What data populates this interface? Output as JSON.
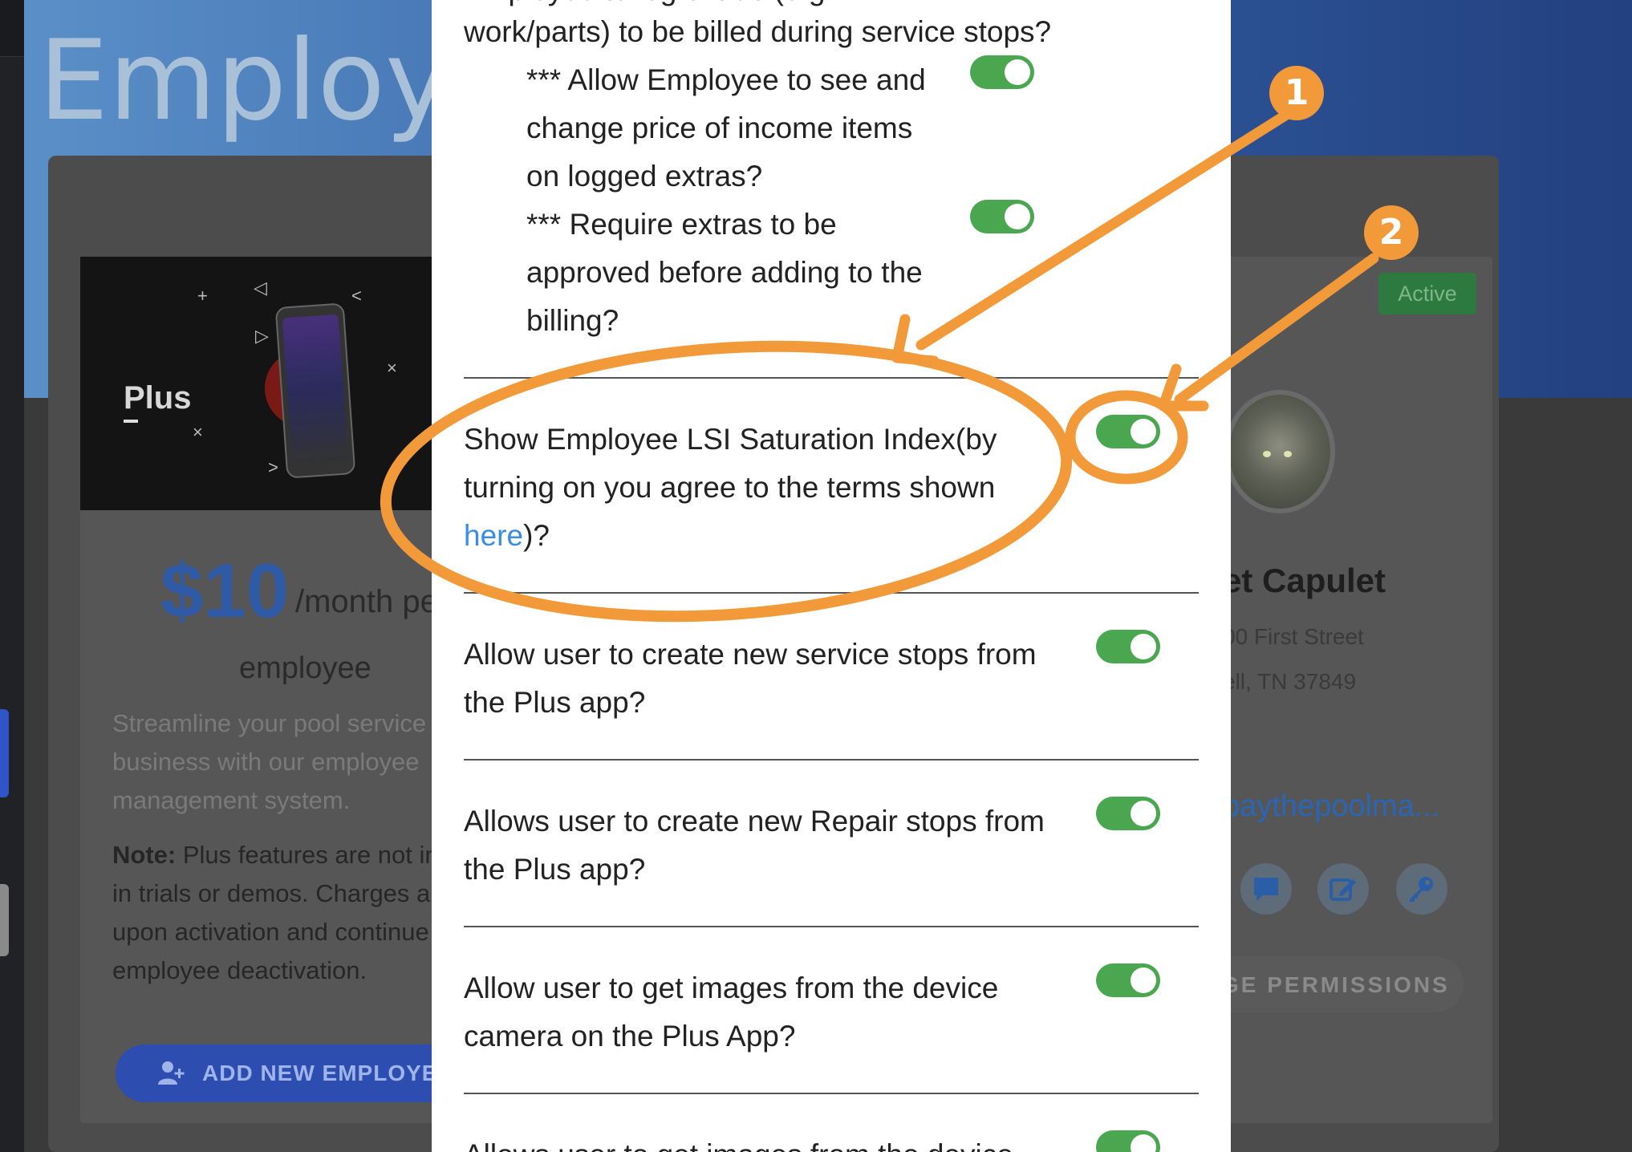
{
  "background": {
    "header_title": "Employe",
    "plan": {
      "logo_text": "Plus",
      "price": "$10",
      "price_unit": "/month pe",
      "name": "employee",
      "description": "Streamline your pool service business with our employee management system.",
      "note_label": "Note:",
      "note_text": " Plus features are not inc in trials or demos. Charges ap upon activation and continue employee deactivation.",
      "add_button": "ADD NEW EMPLOYE"
    },
    "employee": {
      "status_badge": "Active",
      "name": "et Capulet",
      "address_line1": "00 First Street",
      "address_line2": "ell, TN 37849",
      "email": "paythepoolma...",
      "permissions_button": "GE PERMISSIONS"
    }
  },
  "modal": {
    "top_partial": "Employee to log extras (e.g.",
    "top_line": "work/parts) to be billed during service stops?",
    "sub_options": [
      {
        "label": "*** Allow Employee to see and change price of income items on logged extras?",
        "enabled": true
      },
      {
        "label": "*** Require extras to be approved before adding to the billing?",
        "enabled": true
      }
    ],
    "rows": [
      {
        "label_pre": "Show Employee LSI Saturation Index(by turning on you agree to the terms shown ",
        "link": "here",
        "label_post": ")?",
        "enabled": true
      },
      {
        "label": "Allow user to create new service stops from the Plus app?",
        "enabled": true
      },
      {
        "label": "Allows user to create new Repair stops from the Plus app?",
        "enabled": true
      },
      {
        "label": "Allow user to get images from the device camera on the Plus App?",
        "enabled": true
      },
      {
        "label": "Allows user to get images from the device",
        "enabled": true
      }
    ]
  },
  "annotations": {
    "badge_1": "1",
    "badge_2": "2",
    "color": "#f29a3a"
  }
}
